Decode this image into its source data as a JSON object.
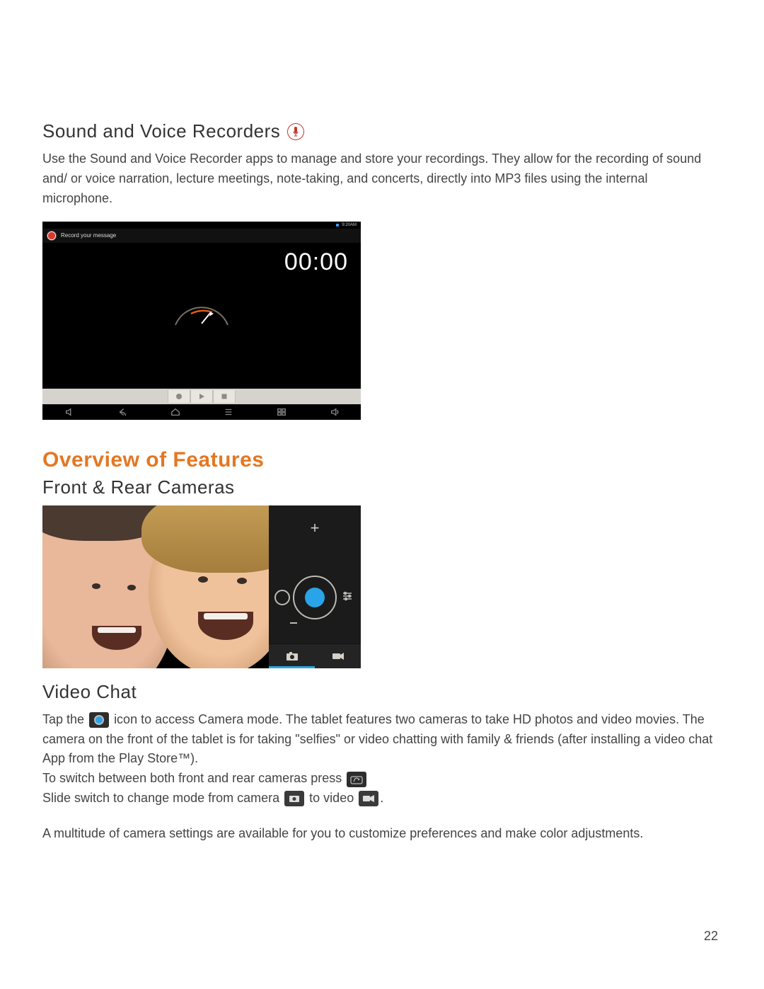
{
  "sections": {
    "sound": {
      "heading": "Sound and Voice Recorders",
      "body": "Use the Sound and Voice Recorder apps to manage and store your recordings. They allow for the recording of sound and/ or voice narration, lecture meetings, note-taking, and concerts, directly into MP3 files using the internal microphone."
    },
    "overview_heading": "Overview of Features",
    "cameras_heading": "Front & Rear Cameras",
    "videochat": {
      "heading": "Video Chat",
      "p1a": "Tap the ",
      "p1b": " icon to access Camera mode. The tablet features two cameras to take HD photos and video movies. The camera on the front of the tablet is for taking \"selfies\" or video chatting with family & friends (after installing a video chat App from the Play Store™).",
      "p2a": "To switch between both front and rear cameras press ",
      "p3a": "Slide switch to change mode from camera ",
      "p3b": " to video ",
      "p3c": ".",
      "p4": "A multitude of camera settings are available for you to customize preferences and make color adjustments."
    }
  },
  "recorder_shot": {
    "app_label": "Record your message",
    "status_time": "9:20AM",
    "timer": "00:00"
  },
  "page_number": "22"
}
